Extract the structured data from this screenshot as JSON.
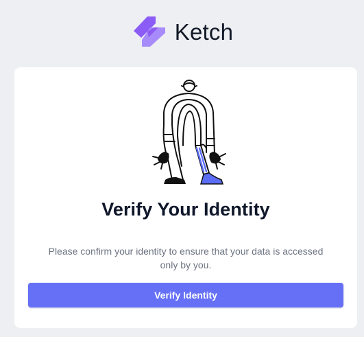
{
  "brand": {
    "name": "Ketch",
    "logo_icon": "ketch-logo-icon",
    "accent": "#8b5cf6"
  },
  "card": {
    "illustration_icon": "person-illustration-icon",
    "title": "Verify Your Identity",
    "description": "Please confirm your identity to ensure that your data is accessed only by you.",
    "button_label": "Verify Identity",
    "button_color": "#6570f6"
  }
}
